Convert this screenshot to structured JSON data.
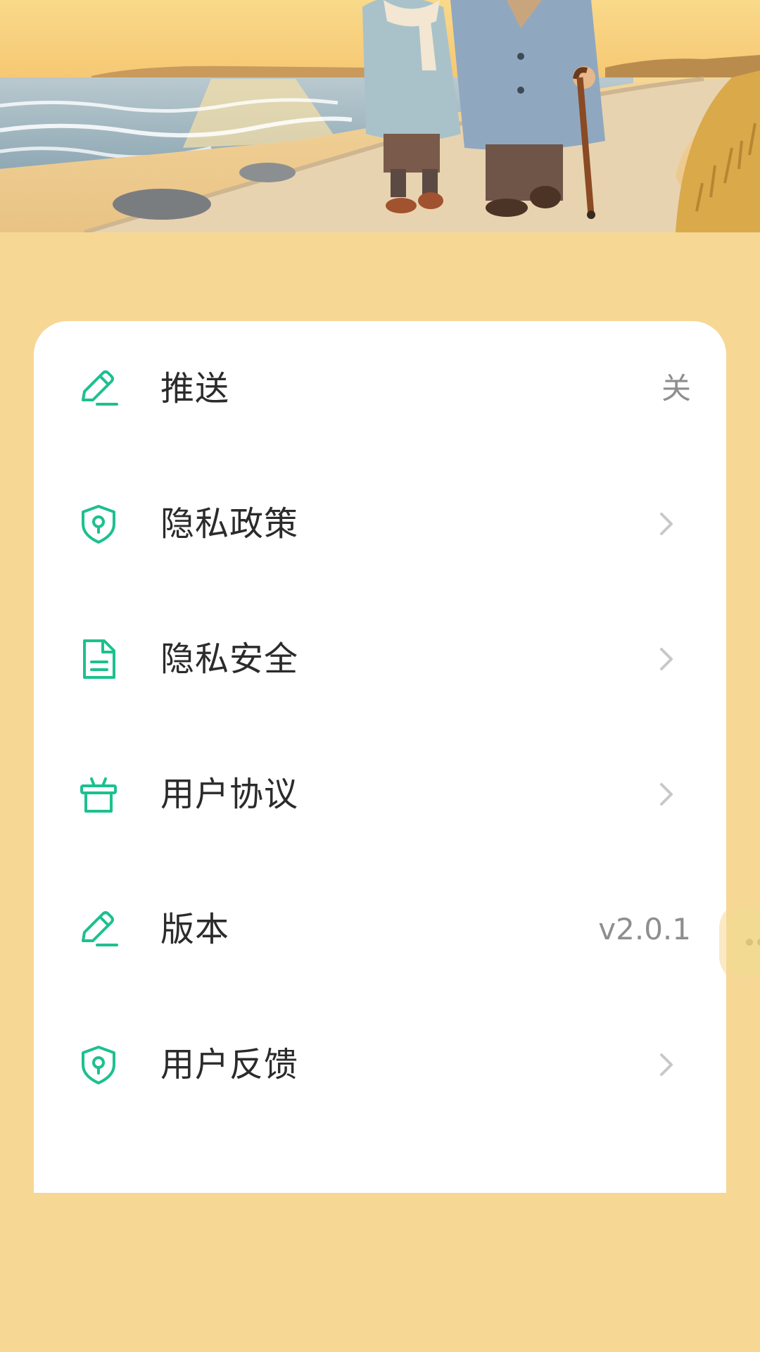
{
  "colors": {
    "background": "#F7D794",
    "card": "#FFFFFF",
    "accent_icon": "#1DC08F",
    "label_text": "#2B2B2B",
    "value_text": "#8E8E8E",
    "chevron": "#C8C8C8"
  },
  "hero": {
    "image": "elderly-couple-beach-walk-illustration"
  },
  "settings": {
    "items": [
      {
        "label": "推送",
        "icon": "pencil-icon",
        "value": "关",
        "chevron": false
      },
      {
        "label": "隐私政策",
        "icon": "shield-lock-icon",
        "value": "",
        "chevron": true
      },
      {
        "label": "隐私安全",
        "icon": "document-icon",
        "value": "",
        "chevron": true
      },
      {
        "label": "用户协议",
        "icon": "gift-box-icon",
        "value": "",
        "chevron": true
      },
      {
        "label": "版本",
        "icon": "pencil-icon",
        "value": "v2.0.1",
        "chevron": false
      },
      {
        "label": "用户反馈",
        "icon": "shield-lock-icon",
        "value": "",
        "chevron": true
      }
    ]
  },
  "floating_button": {
    "icon": "more-dots-icon"
  }
}
